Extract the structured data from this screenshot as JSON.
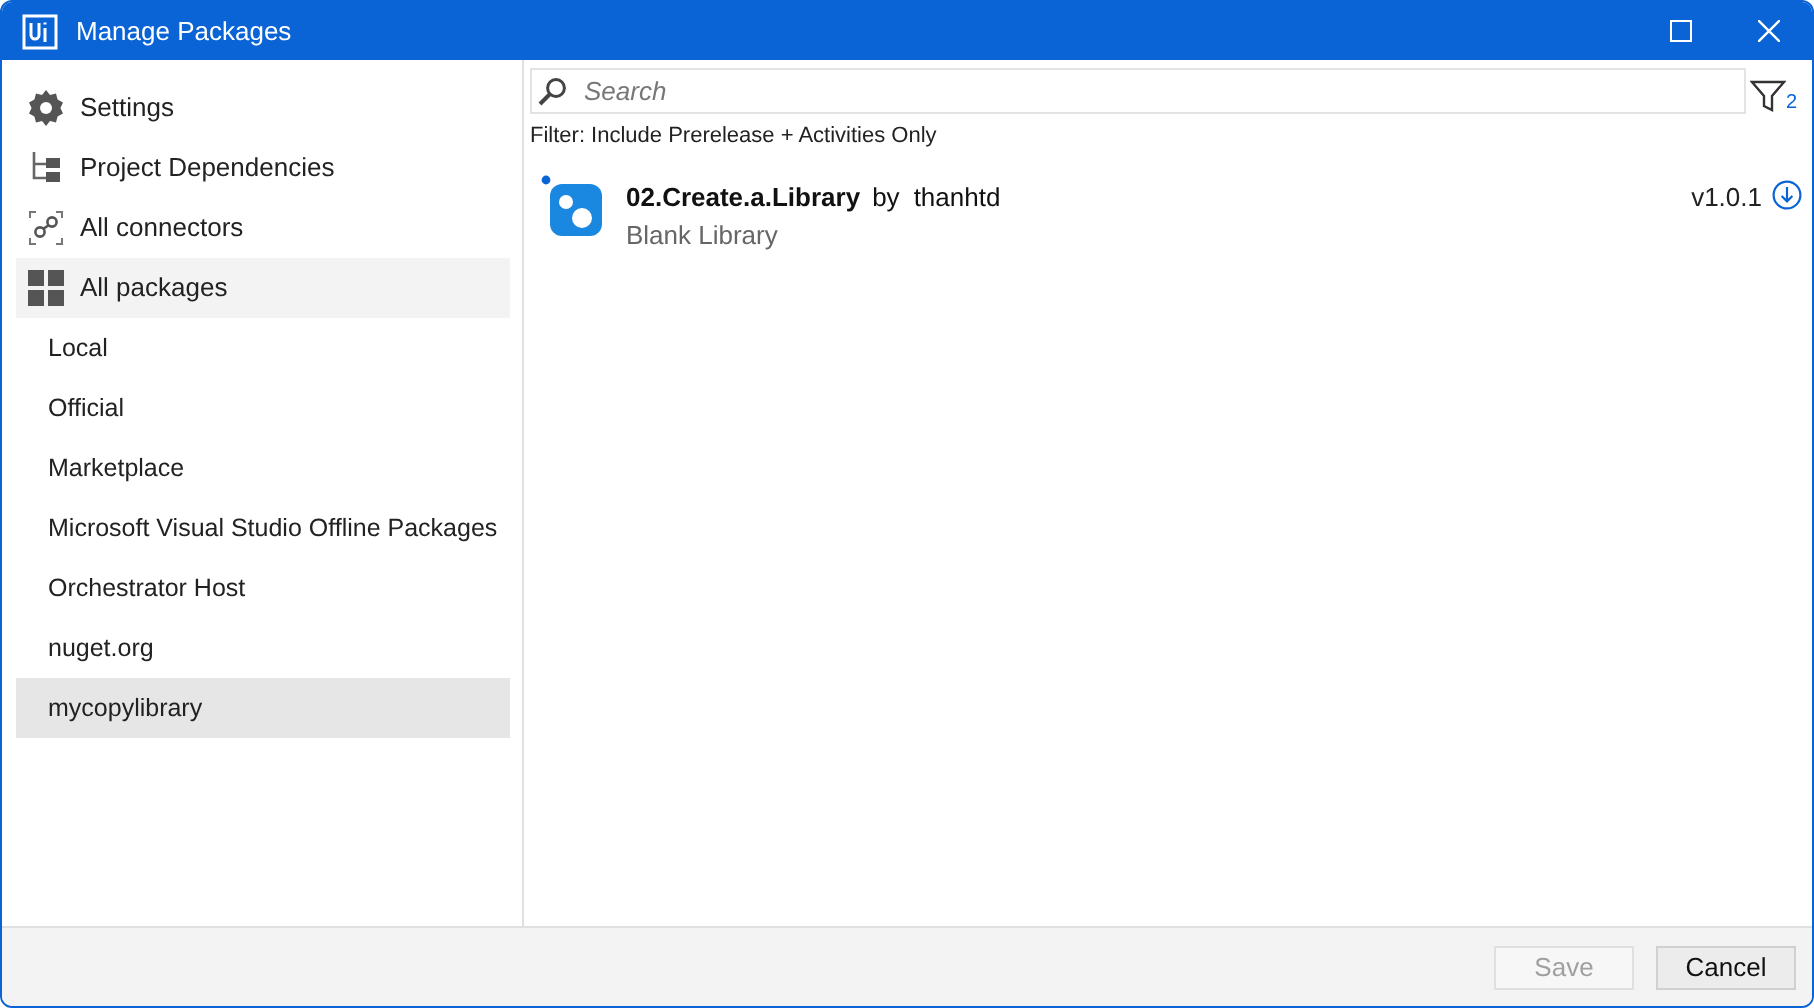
{
  "window": {
    "title": "Manage Packages"
  },
  "sidebar": {
    "nav_items": [
      {
        "label": "Settings",
        "selected": false
      },
      {
        "label": "Project Dependencies",
        "selected": false
      },
      {
        "label": "All connectors",
        "selected": false
      },
      {
        "label": "All packages",
        "selected": true
      }
    ],
    "sources": [
      {
        "label": "Local",
        "selected": false
      },
      {
        "label": "Official",
        "selected": false
      },
      {
        "label": "Marketplace",
        "selected": false
      },
      {
        "label": "Microsoft Visual Studio Offline Packages",
        "selected": false
      },
      {
        "label": "Orchestrator Host",
        "selected": false
      },
      {
        "label": "nuget.org",
        "selected": false
      },
      {
        "label": "mycopylibrary",
        "selected": true
      }
    ]
  },
  "search": {
    "placeholder": "Search"
  },
  "filter": {
    "count": "2",
    "summary": "Filter: Include Prerelease + Activities Only"
  },
  "packages": [
    {
      "name": "02.Create.a.Library",
      "by": "by",
      "author": "thanhtd",
      "description": "Blank Library",
      "version": "v1.0.1"
    }
  ],
  "buttons": [
    {
      "label": "Save",
      "disabled": true
    },
    {
      "label": "Cancel",
      "disabled": false
    }
  ]
}
